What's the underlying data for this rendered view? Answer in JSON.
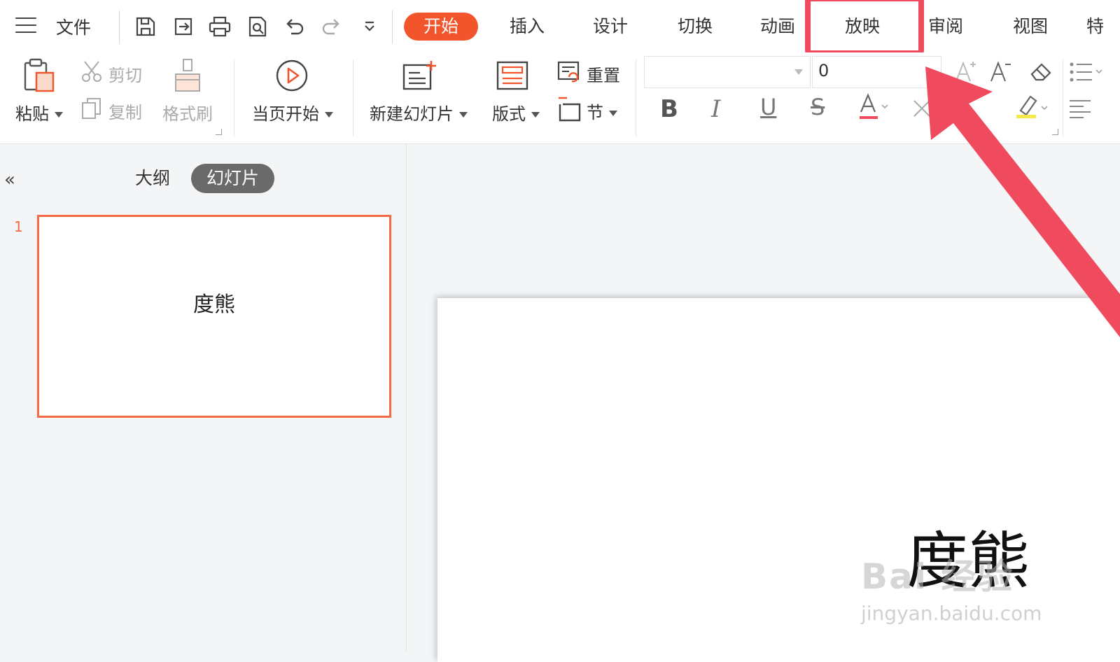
{
  "tabbar": {
    "file_label": "文件",
    "tabs": [
      {
        "label": "开始",
        "active": true
      },
      {
        "label": "插入"
      },
      {
        "label": "设计"
      },
      {
        "label": "切换"
      },
      {
        "label": "动画"
      },
      {
        "label": "放映",
        "highlighted": true
      },
      {
        "label": "审阅"
      },
      {
        "label": "视图"
      },
      {
        "label": "特"
      }
    ],
    "quick_access_icons": [
      "save-icon",
      "export-icon",
      "print-icon",
      "preview-icon",
      "undo-icon",
      "redo-icon",
      "customize-icon"
    ]
  },
  "ribbon": {
    "paste": "粘贴",
    "cut": "剪切",
    "copy": "复制",
    "format_painter": "格式刷",
    "from_current": "当页开始",
    "new_slide": "新建幻灯片",
    "layout": "版式",
    "reset": "重置",
    "section": "节",
    "font_size_value": "0"
  },
  "left_panel": {
    "outline_tab": "大纲",
    "slides_tab": "幻灯片",
    "slide_number": "1",
    "thumbnail_title": "度熊"
  },
  "slide": {
    "title": "度熊"
  },
  "watermark": {
    "main": "Bai 经验",
    "sub": "jingyan.baidu.com"
  },
  "colors": {
    "accent": "#f2552c",
    "highlight": "#f04a5e",
    "thumbnail_border": "#f26b43"
  }
}
